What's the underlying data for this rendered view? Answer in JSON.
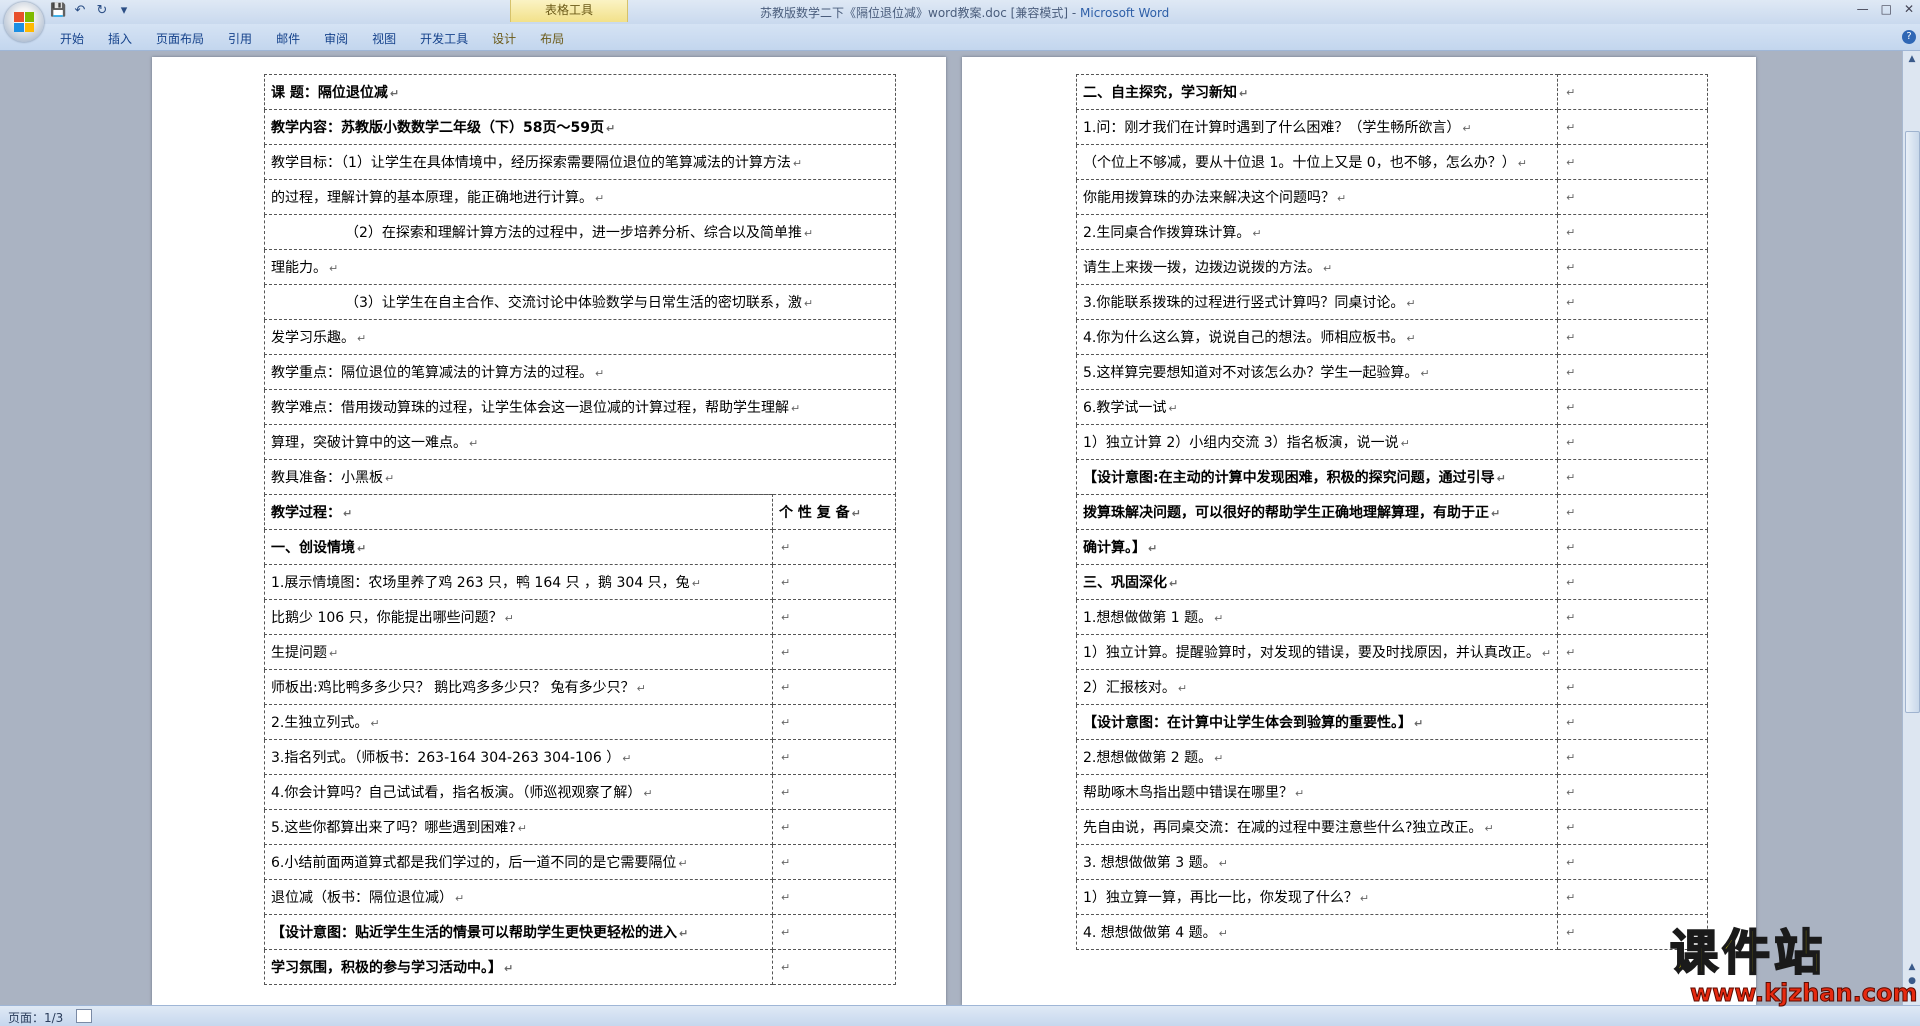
{
  "window": {
    "title": "苏教版数学二下《隔位退位减》word教案.doc [兼容模式] - ",
    "app_name": "Microsoft Word",
    "context_tab_group": "表格工具"
  },
  "ribbon_tabs": [
    "开始",
    "插入",
    "页面布局",
    "引用",
    "邮件",
    "审阅",
    "视图",
    "开发工具",
    "设计",
    "布局"
  ],
  "page1": {
    "rows": [
      {
        "a": "课      题：隔位退位减",
        "bold": true
      },
      {
        "a": "教学内容：苏教版小数数学二年级（下）58页～59页",
        "bold": true
      },
      {
        "a": "教学目标：（1）让学生在具体情境中，经历探索需要隔位退位的笔算减法的计算方法",
        "label": "教学目标："
      },
      {
        "a": "的过程，理解计算的基本原理，能正确地进行计算。"
      },
      {
        "a": "（2）在探索和理解计算方法的过程中，进一步培养分析、综合以及简单推",
        "indent": true
      },
      {
        "a": "理能力。"
      },
      {
        "a": "（3）让学生在自主合作、交流讨论中体验数学与日常生活的密切联系，激",
        "indent": true
      },
      {
        "a": "发学习乐趣。"
      },
      {
        "a": "教学重点：隔位退位的笔算减法的计算方法的过程。",
        "label": "教学重点："
      },
      {
        "a": "教学难点：借用拨动算珠的过程，让学生体会这一退位减的计算过程，帮助学生理解",
        "label": "教学难点："
      },
      {
        "a": "算理，突破计算中的这一难点。"
      },
      {
        "a": "教具准备：小黑板",
        "label": "教具准备："
      }
    ],
    "process_header": {
      "left": "教学过程：",
      "right": "个  性  复  备"
    },
    "process_rows": [
      {
        "a": "一、创设情境",
        "bold": true
      },
      {
        "a": "1.展示情境图：农场里养了鸡 263 只，鸭 164 只 ，鹅 304 只，兔"
      },
      {
        "a": "比鹅少 106 只，你能提出哪些问题？"
      },
      {
        "a": "生提问题"
      },
      {
        "a": "师板出:鸡比鸭多多少只？  鹅比鸡多多少只？  兔有多少只？"
      },
      {
        "a": "2.生独立列式。"
      },
      {
        "a": "3.指名列式。（师板书：263-164      304-263       304-106 ）"
      },
      {
        "a": "4.你会计算吗？自己试试看，指名板演。（师巡视观察了解）"
      },
      {
        "a": "5.这些你都算出来了吗？哪些遇到困难?"
      },
      {
        "a": "6.小结前面两道算式都是我们学过的，后一道不同的是它需要隔位"
      },
      {
        "a": "退位减（板书：隔位退位减）"
      },
      {
        "a": "【设计意图：贴近学生生活的情景可以帮助学生更快更轻松的进入",
        "bold": true
      },
      {
        "a": "学习氛围，积极的参与学习活动中。】",
        "bold": true
      }
    ]
  },
  "page2": {
    "rows": [
      {
        "a": "二、自主探究，学习新知",
        "bold": true
      },
      {
        "a": "1.问：刚才我们在计算时遇到了什么困难？（学生畅所欲言）"
      },
      {
        "a": "（个位上不够减，要从十位退 1。十位上又是 0，也不够，怎么办？）"
      },
      {
        "a": "    你能用拨算珠的办法来解决这个问题吗？"
      },
      {
        "a": "2.生同桌合作拨算珠计算。"
      },
      {
        "a": "请生上来拨一拨，边拨边说拨的方法。"
      },
      {
        "a": "3.你能联系拨珠的过程进行竖式计算吗？同桌讨论。"
      },
      {
        "a": "4.你为什么这么算，说说自己的想法。师相应板书。"
      },
      {
        "a": "5.这样算完要想知道对不对该怎么办？学生一起验算。"
      },
      {
        "a": "6.教学试一试"
      },
      {
        "a": "1）独立计算       2）小组内交流       3）指名板演，说一说"
      },
      {
        "a": "【设计意图:在主动的计算中发现困难，积极的探究问题，通过引导",
        "bold": true
      },
      {
        "a": "拨算珠解决问题，可以很好的帮助学生正确地理解算理，有助于正",
        "bold": true
      },
      {
        "a": "确计算。】",
        "bold": true
      },
      {
        "a": "三、巩固深化",
        "bold": true
      },
      {
        "a": "1.想想做做第 1 题。"
      },
      {
        "a": "1）独立计算。提醒验算时，对发现的错误，要及时找原因，并认真改正。"
      },
      {
        "a": "2）汇报核对。"
      },
      {
        "a": "【设计意图：在计算中让学生体会到验算的重要性。】",
        "bold": true
      },
      {
        "a": "2.想想做做第 2 题。"
      },
      {
        "a": "帮助啄木鸟指出题中错误在哪里？"
      },
      {
        "a": "先自由说，再同桌交流：在减的过程中要注意些什么?独立改正。"
      },
      {
        "a": "3. 想想做做第 3 题。"
      },
      {
        "a": "1）独立算一算，再比一比，你发现了什么？"
      },
      {
        "a": "4. 想想做做第 4 题。"
      }
    ]
  },
  "status": {
    "page": "页面：1/3"
  },
  "watermark": {
    "text": "课件站",
    "url": "www.kjzhan.com"
  }
}
